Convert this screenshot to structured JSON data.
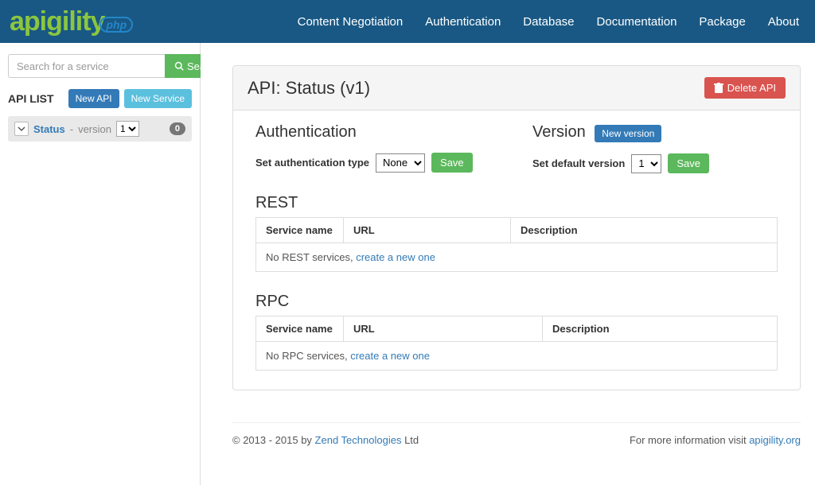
{
  "nav": {
    "items": [
      "Content Negotiation",
      "Authentication",
      "Database",
      "Documentation",
      "Package",
      "About"
    ]
  },
  "logo": {
    "main": "apigility",
    "sub": "php"
  },
  "sidebar": {
    "search_placeholder": "Search for a service",
    "search_btn": "Search",
    "heading": "API LIST",
    "new_api_btn": "New API",
    "new_service_btn": "New Service",
    "api": {
      "name": "Status",
      "label_version": "version",
      "selected_version": "1",
      "count": "0"
    }
  },
  "panel": {
    "title": "API: Status (v1)",
    "delete_btn": "Delete API"
  },
  "auth": {
    "heading": "Authentication",
    "label": "Set authentication type",
    "value": "None",
    "save": "Save"
  },
  "version": {
    "heading": "Version",
    "new_btn": "New version",
    "label": "Set default version",
    "value": "1",
    "save": "Save"
  },
  "rest": {
    "heading": "REST",
    "cols": [
      "Service name",
      "URL",
      "Description"
    ],
    "empty_text": "No REST services, ",
    "empty_link": "create a new one"
  },
  "rpc": {
    "heading": "RPC",
    "cols": [
      "Service name",
      "URL",
      "Description"
    ],
    "empty_text": "No RPC services, ",
    "empty_link": "create a new one"
  },
  "footer": {
    "left_c": "© 2013 - 2015 by ",
    "left_link": "Zend Technologies",
    "left_tail": " Ltd",
    "right_text": "For more information visit ",
    "right_link": "apigility.org"
  }
}
